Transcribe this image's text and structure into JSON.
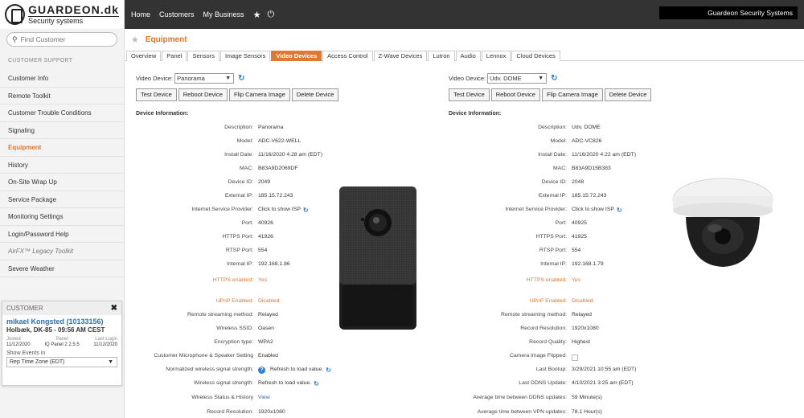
{
  "sidebar": {
    "brand_top": "GUARDEON.dk",
    "brand_bottom": "Security systems",
    "find_placeholder": "Find Customer",
    "section_label": "CUSTOMER SUPPORT",
    "items": [
      {
        "label": "Customer Info"
      },
      {
        "label": "Remote Toolkit"
      },
      {
        "label": "Customer Trouble Conditions"
      },
      {
        "label": "Signaling"
      },
      {
        "label": "Equipment"
      },
      {
        "label": "History"
      },
      {
        "label": "On-Site Wrap Up"
      },
      {
        "label": "Service Package"
      },
      {
        "label": "Monitoring Settings"
      },
      {
        "label": "Login/Password Help"
      },
      {
        "label": "AirFX™ Legacy Toolkit"
      },
      {
        "label": "Severe Weather"
      }
    ],
    "active_index": 4
  },
  "customer_card": {
    "header": "CUSTOMER",
    "name": "mikael Kongsted (10133156)",
    "location": "Holbæk, DK-85 - 09:56 AM CEST",
    "col_labels": [
      "Joined",
      "Panel",
      "Last Login"
    ],
    "col_values": [
      "11/12/2020",
      "IQ Panel 2 2.5.5",
      "11/12/2020"
    ],
    "events_label": "Show Events in",
    "events_value": "Rep Time Zone (EDT)"
  },
  "topbar": {
    "links": [
      "Home",
      "Customers",
      "My Business"
    ],
    "account": "Guardeon Security Systems"
  },
  "page": {
    "title": "Equipment",
    "tabs": [
      "Overview",
      "Panel",
      "Sensors",
      "Image Sensors",
      "Video Devices",
      "Access Control",
      "Z-Wave Devices",
      "Lutron",
      "Audio",
      "Lennox",
      "Cloud Devices"
    ],
    "active_tab": "Video Devices"
  },
  "left_device": {
    "select_label": "Video Device:",
    "selected": "Panorama",
    "buttons": [
      "Test Device",
      "Reboot Device",
      "Flip Camera Image",
      "Delete Device"
    ],
    "info_label": "Device Information:",
    "fields": [
      {
        "k": "Description:",
        "v": "Panorama"
      },
      {
        "k": "Model:",
        "v": "ADC-V622-WELL"
      },
      {
        "k": "Install Date:",
        "v": "11/16/2020 4:28 am (EDT)"
      },
      {
        "k": "MAC:",
        "v": "B83A9D2069DF"
      },
      {
        "k": "Device ID:",
        "v": "2049"
      },
      {
        "k": "External IP:",
        "v": "185.15.72.243"
      },
      {
        "k": "Internet Service Provider:",
        "v": "Click to show ISP"
      },
      {
        "k": "Port:",
        "v": "40926"
      },
      {
        "k": "HTTPS Port:",
        "v": "41926"
      },
      {
        "k": "RTSP Port:",
        "v": "554"
      },
      {
        "k": "Internal IP:",
        "v": "192.168.1.86"
      },
      {
        "k": "HTTPS enabled:",
        "v": "Yes"
      },
      {
        "k": "UPnP Enabled:",
        "v": "Disabled"
      },
      {
        "k": "Remote streaming method:",
        "v": "Relayed"
      },
      {
        "k": "Wireless SSID:",
        "v": "Oasen"
      },
      {
        "k": "Encryption type:",
        "v": "WPA2"
      },
      {
        "k": "Customer Microphone & Speaker Setting",
        "v": "Enabled"
      },
      {
        "k": "Normalized wireless signal strength:",
        "v": "Refresh to load value."
      },
      {
        "k": "Wireless signal strength:",
        "v": "Refresh to load value."
      },
      {
        "k": "Wireless Status & History",
        "v": "View"
      },
      {
        "k": "Record Resolution:",
        "v": "1920x1080"
      }
    ]
  },
  "right_device": {
    "select_label": "Video Device:",
    "selected": "Udv. DOME",
    "buttons": [
      "Test Device",
      "Reboot Device",
      "Flip Camera Image",
      "Delete Device"
    ],
    "info_label": "Device Information:",
    "fields": [
      {
        "k": "Description:",
        "v": "Udv. DOME"
      },
      {
        "k": "Model:",
        "v": "ADC-VC826"
      },
      {
        "k": "Install Date:",
        "v": "11/16/2020 4:22 am (EDT)"
      },
      {
        "k": "MAC:",
        "v": "B83A9D15B383"
      },
      {
        "k": "Device ID:",
        "v": "2048"
      },
      {
        "k": "External IP:",
        "v": "185.15.72.243"
      },
      {
        "k": "Internet Service Provider:",
        "v": "Click to show ISP"
      },
      {
        "k": "Port:",
        "v": "40925"
      },
      {
        "k": "HTTPS Port:",
        "v": "41925"
      },
      {
        "k": "RTSP Port:",
        "v": "554"
      },
      {
        "k": "Internal IP:",
        "v": "192.168.1.79"
      },
      {
        "k": "HTTPS enabled:",
        "v": "Yes"
      },
      {
        "k": "UPnP Enabled:",
        "v": "Disabled"
      },
      {
        "k": "Remote streaming method:",
        "v": "Relayed"
      },
      {
        "k": "Record Resolution:",
        "v": "1920x1080"
      },
      {
        "k": "Record Quality:",
        "v": "Highest"
      },
      {
        "k": "Camera Image Flipped:",
        "v": ""
      },
      {
        "k": "Last Bootup:",
        "v": "3/29/2021 10:55 am (EDT)"
      },
      {
        "k": "Last DDNS Update:",
        "v": "4/10/2021 3:25 am (EDT)"
      },
      {
        "k": "Average time between DDNS updates:",
        "v": "59 Minute(s)"
      },
      {
        "k": "Average time between VPN updates:",
        "v": "78.1 Hour(s)"
      }
    ]
  },
  "colors": {
    "accent": "#e0782e",
    "topbar": "#333333",
    "link": "#2a6fb5",
    "refresh": "#2a7de1"
  }
}
